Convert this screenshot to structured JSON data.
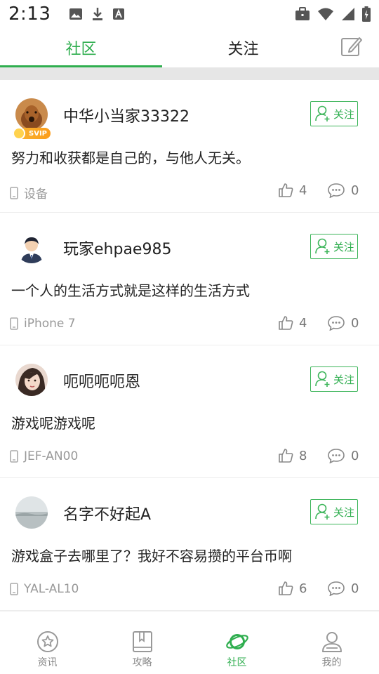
{
  "status_bar": {
    "time": "2:13"
  },
  "tabs": {
    "community": "社区",
    "follow": "关注"
  },
  "colors": {
    "accent": "#2fae4f",
    "text": "#222222",
    "muted": "#999999",
    "divider": "#e6e6e6"
  },
  "posts": [
    {
      "username": "中华小当家33322",
      "vip": "SVIP",
      "follow_label": "关注",
      "text": "努力和收获都是自己的，与他人无关。",
      "device": "设备",
      "likes": "4",
      "comments": "0"
    },
    {
      "username": "玩家ehpae985",
      "follow_label": "关注",
      "text": "一个人的生活方式就是这样的生活方式",
      "device": "iPhone 7",
      "likes": "4",
      "comments": "0"
    },
    {
      "username": "呃呃呃呃恩",
      "follow_label": "关注",
      "text": "游戏呢游戏呢",
      "device": "JEF-AN00",
      "likes": "8",
      "comments": "0"
    },
    {
      "username": "名字不好起A",
      "follow_label": "关注",
      "text": "游戏盒子去哪里了？我好不容易攒的平台币啊",
      "device": "YAL-AL10",
      "likes": "6",
      "comments": "0"
    }
  ],
  "bottom_nav": {
    "news": "资讯",
    "guide": "攻略",
    "community": "社区",
    "mine": "我的"
  },
  "icons": [
    "image-icon",
    "download-icon",
    "text-icon",
    "briefcase-icon",
    "wifi-icon",
    "signal-icon",
    "battery-icon",
    "compose-icon",
    "person-add-icon",
    "phone-icon",
    "thumbs-up-icon",
    "comment-icon",
    "star-icon",
    "book-icon",
    "planet-icon",
    "user-icon"
  ]
}
